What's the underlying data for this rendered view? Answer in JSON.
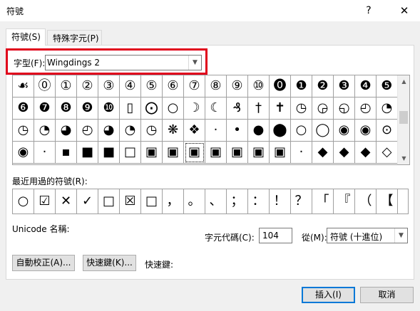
{
  "dialog": {
    "title": "符號",
    "help": "?",
    "close": "✕"
  },
  "tabs": [
    {
      "label": "符號(S)"
    },
    {
      "label": "特殊字元(P)"
    }
  ],
  "font": {
    "label": "字型(F):",
    "value": "Wingdings 2"
  },
  "grid": {
    "rows": [
      [
        "☙",
        "⓪",
        "①",
        "②",
        "③",
        "④",
        "⑤",
        "⑥",
        "⑦",
        "⑧",
        "⑨",
        "⑩",
        "⓿",
        "❶",
        "❷",
        "❸",
        "❹",
        "❺"
      ],
      [
        "❻",
        "❼",
        "❽",
        "❾",
        "❿",
        "▯",
        "⨀",
        "○",
        "☽",
        "☾",
        "₰",
        "†",
        "✝",
        "◷",
        "◶",
        "◵",
        "◴",
        "◔"
      ],
      [
        "◷",
        "◔",
        "◕",
        "◴",
        "◕",
        "◔",
        "◷",
        "❋",
        "❖",
        "·",
        "•",
        "●",
        "⬤",
        "○",
        "◯",
        "◉",
        "◉",
        "⊙"
      ],
      [
        "◉",
        "·",
        "▪",
        "■",
        "■",
        "□",
        "▣",
        "▣",
        "▣",
        "▣",
        "▣",
        "▣",
        "▣",
        "·",
        "◆",
        "◆",
        "◆",
        "◇"
      ]
    ],
    "selected": [
      3,
      8
    ]
  },
  "recent": {
    "label": "最近用過的符號(R):",
    "items": [
      "○",
      "☑",
      "✕",
      "✓",
      "□",
      "☒",
      "□",
      "，",
      "。",
      "、",
      "；",
      "：",
      "！",
      "？",
      "「",
      "『",
      "（",
      "【"
    ]
  },
  "unicode": {
    "label": "Unicode 名稱:"
  },
  "code": {
    "label": "字元代碼(C):",
    "value": "104"
  },
  "from": {
    "label": "從(M):",
    "value": "符號 (十進位)"
  },
  "buttons": {
    "autocorrect": "自動校正(A)...",
    "shortcut": "快速鍵(K)...",
    "shortcut_label": "快速鍵:",
    "insert": "插入(I)",
    "cancel": "取消"
  }
}
